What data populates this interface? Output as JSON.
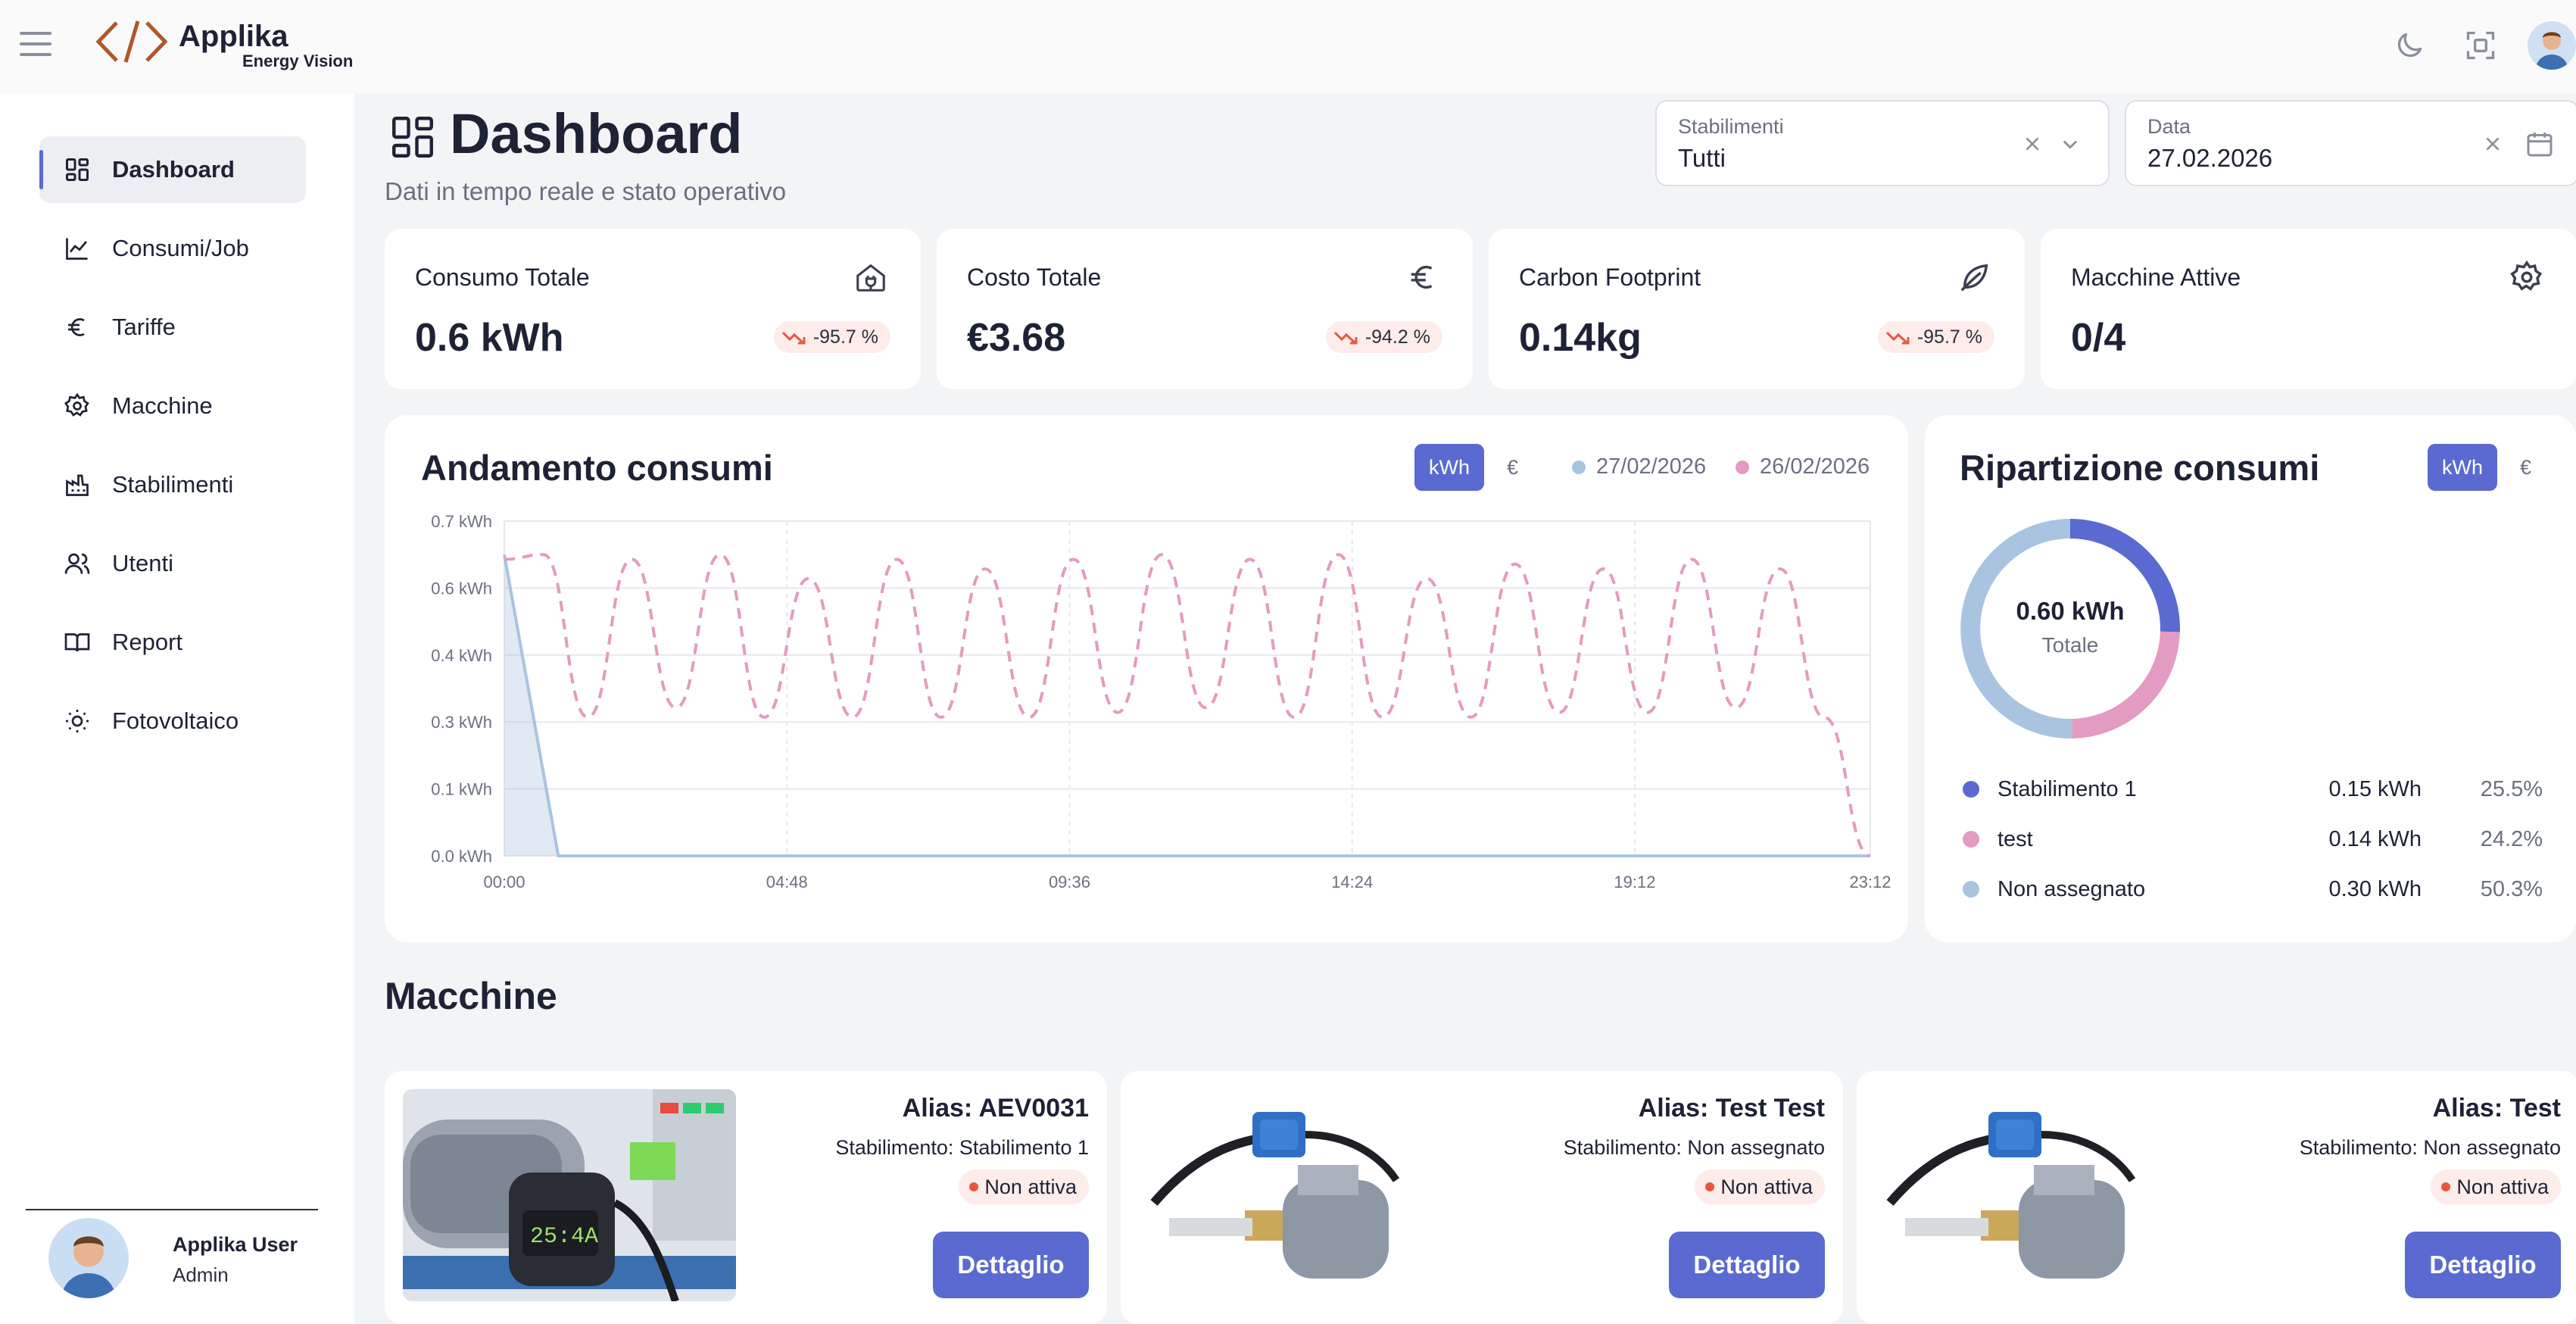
{
  "app": {
    "name": "Applika",
    "tagline": "Energy Vision"
  },
  "sidebar": {
    "items": [
      {
        "label": "Dashboard",
        "icon": "grid-icon",
        "active": true
      },
      {
        "label": "Consumi/Job",
        "icon": "chart-line-icon"
      },
      {
        "label": "Tariffe",
        "icon": "euro-icon"
      },
      {
        "label": "Macchine",
        "icon": "gear-icon"
      },
      {
        "label": "Stabilimenti",
        "icon": "factory-icon"
      },
      {
        "label": "Utenti",
        "icon": "users-icon"
      },
      {
        "label": "Report",
        "icon": "book-icon"
      },
      {
        "label": "Fotovoltaico",
        "icon": "sun-icon"
      }
    ],
    "user": {
      "name": "Applika User",
      "role": "Admin"
    }
  },
  "header": {
    "title": "Dashboard",
    "subtitle": "Dati in tempo reale e stato operativo"
  },
  "filters": {
    "stabilimenti": {
      "label": "Stabilimenti",
      "value": "Tutti"
    },
    "data": {
      "label": "Data",
      "value": "27.02.2026"
    }
  },
  "kpis": [
    {
      "label": "Consumo Totale",
      "value": "0.6 kWh",
      "delta": "-95.7 %",
      "icon": "plug-home-icon"
    },
    {
      "label": "Costo Totale",
      "value": "€3.68",
      "delta": "-94.2 %",
      "icon": "euro-icon"
    },
    {
      "label": "Carbon Footprint",
      "value": "0.14kg",
      "delta": "-95.7 %",
      "icon": "leaf-icon"
    },
    {
      "label": "Macchine Attive",
      "value": "0/4",
      "icon": "gear-icon"
    }
  ],
  "trend": {
    "title": "Andamento consumi",
    "unit_active": "kWh",
    "unit_alt": "€"
  },
  "breakdown": {
    "title": "Ripartizione consumi",
    "unit_active": "kWh",
    "unit_alt": "€",
    "total_value": "0.60 kWh",
    "total_label": "Totale",
    "rows": [
      {
        "label": "Stabilimento 1",
        "value": "0.15 kWh",
        "pct": "25.5%",
        "color": "#5b6ad0"
      },
      {
        "label": "test",
        "value": "0.14 kWh",
        "pct": "24.2%",
        "color": "#e39bc1"
      },
      {
        "label": "Non assegnato",
        "value": "0.30 kWh",
        "pct": "50.3%",
        "color": "#a9c4e0"
      }
    ]
  },
  "machines": {
    "title": "Macchine",
    "cards": [
      {
        "alias": "Alias: AEV0031",
        "site": "Stabilimento: Stabilimento 1",
        "status": "Non attiva",
        "button": "Dettaglio",
        "display": "25:4A"
      },
      {
        "alias": "Alias: Test Test",
        "site": "Stabilimento: Non assegnato",
        "status": "Non attiva",
        "button": "Dettaglio"
      },
      {
        "alias": "Alias: Test",
        "site": "Stabilimento: Non assegnato",
        "status": "Non attiva",
        "button": "Dettaglio"
      }
    ]
  },
  "colors": {
    "accent": "#5b6ad0",
    "series_current": "#a9c4e0",
    "series_previous": "#e39bc1",
    "badge_bg": "#fdecea",
    "status_dot": "#e4583e"
  },
  "chart_data": [
    {
      "type": "line",
      "title": "Andamento consumi",
      "xlabel": "",
      "ylabel": "",
      "x_ticks": [
        "00:00",
        "04:48",
        "09:36",
        "14:24",
        "19:12",
        "23:12"
      ],
      "y_ticks": [
        "0.0 kWh",
        "0.1 kWh",
        "0.3 kWh",
        "0.4 kWh",
        "0.6 kWh",
        "0.7 kWh"
      ],
      "ylim": [
        0,
        0.7
      ],
      "grid": true,
      "legend": "top-right",
      "series": [
        {
          "name": "27/02/2026",
          "color": "#a9c4e0",
          "style": "solid-area",
          "x": [
            "00:00",
            "00:55",
            "01:12",
            "02:00",
            "23:12"
          ],
          "values": [
            0.63,
            0.0,
            0.0,
            0.0,
            0.0
          ]
        },
        {
          "name": "26/02/2026",
          "color": "#e39bc1",
          "style": "dashed",
          "x": [
            "00:00",
            "00:40",
            "01:25",
            "02:10",
            "02:55",
            "03:40",
            "04:25",
            "05:10",
            "05:55",
            "06:40",
            "07:25",
            "08:10",
            "08:55",
            "09:40",
            "10:25",
            "11:10",
            "11:55",
            "12:40",
            "13:25",
            "14:10",
            "14:55",
            "15:40",
            "16:25",
            "17:10",
            "17:55",
            "18:40",
            "19:25",
            "20:10",
            "20:55",
            "21:40",
            "22:25",
            "23:12"
          ],
          "values": [
            0.62,
            0.63,
            0.29,
            0.62,
            0.31,
            0.63,
            0.29,
            0.58,
            0.29,
            0.62,
            0.29,
            0.6,
            0.29,
            0.62,
            0.3,
            0.63,
            0.31,
            0.62,
            0.29,
            0.63,
            0.29,
            0.58,
            0.29,
            0.61,
            0.3,
            0.6,
            0.3,
            0.62,
            0.31,
            0.6,
            0.29,
            0.0
          ]
        }
      ]
    },
    {
      "type": "pie",
      "variant": "donut",
      "title": "Ripartizione consumi",
      "categories": [
        "Stabilimento 1",
        "test",
        "Non assegnato"
      ],
      "values": [
        25.5,
        24.2,
        50.3
      ],
      "colors": [
        "#5b6ad0",
        "#e39bc1",
        "#a9c4e0"
      ]
    }
  ]
}
